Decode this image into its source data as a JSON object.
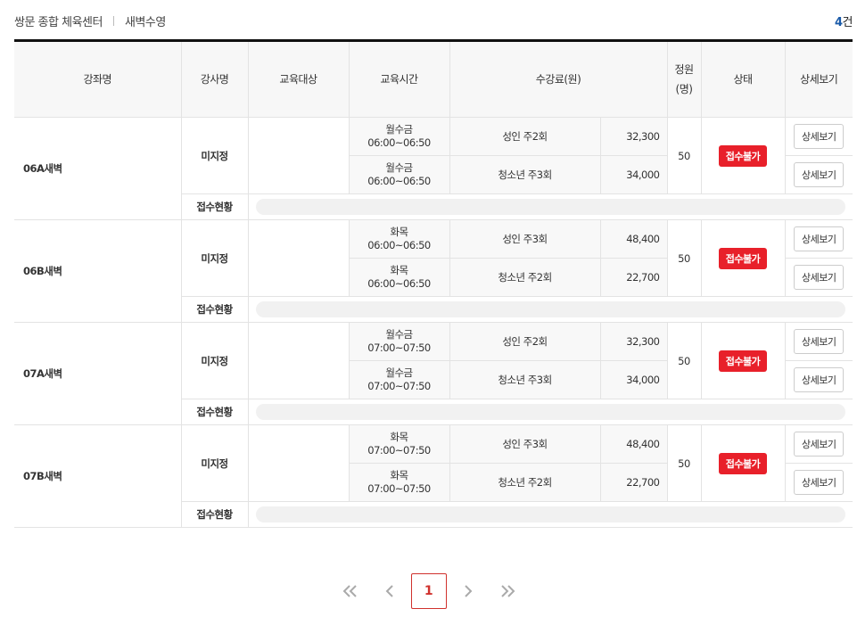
{
  "breadcrumb": {
    "center": "쌍문 종합 체육센터",
    "program": "새벽수영"
  },
  "count": {
    "num": "4",
    "unit": "건"
  },
  "table": {
    "headers": {
      "course": "강좌명",
      "instructor": "강사명",
      "target": "교육대상",
      "time": "교육시간",
      "fee": "수강료(원)",
      "capacity_line1": "정원",
      "capacity_line2": "(명)",
      "status": "상태",
      "detail": "상세보기"
    },
    "rows": [
      {
        "course": "06A새벽",
        "instructor": "미지정",
        "capacity": "50",
        "status": "접수불가",
        "progress_label": "접수현황",
        "sessions": [
          {
            "days": "월수금",
            "time": "06:00~06:50",
            "fee_name": "성인 주2회",
            "fee": "32,300",
            "detail": "상세보기"
          },
          {
            "days": "월수금",
            "time": "06:00~06:50",
            "fee_name": "청소년 주3회",
            "fee": "34,000",
            "detail": "상세보기"
          }
        ]
      },
      {
        "course": "06B새벽",
        "instructor": "미지정",
        "capacity": "50",
        "status": "접수불가",
        "progress_label": "접수현황",
        "sessions": [
          {
            "days": "화목",
            "time": "06:00~06:50",
            "fee_name": "성인 주3회",
            "fee": "48,400",
            "detail": "상세보기"
          },
          {
            "days": "화목",
            "time": "06:00~06:50",
            "fee_name": "청소년 주2회",
            "fee": "22,700",
            "detail": "상세보기"
          }
        ]
      },
      {
        "course": "07A새벽",
        "instructor": "미지정",
        "capacity": "50",
        "status": "접수불가",
        "progress_label": "접수현황",
        "sessions": [
          {
            "days": "월수금",
            "time": "07:00~07:50",
            "fee_name": "성인 주2회",
            "fee": "32,300",
            "detail": "상세보기"
          },
          {
            "days": "월수금",
            "time": "07:00~07:50",
            "fee_name": "청소년 주3회",
            "fee": "34,000",
            "detail": "상세보기"
          }
        ]
      },
      {
        "course": "07B새벽",
        "instructor": "미지정",
        "capacity": "50",
        "status": "접수불가",
        "progress_label": "접수현황",
        "sessions": [
          {
            "days": "화목",
            "time": "07:00~07:50",
            "fee_name": "성인 주3회",
            "fee": "48,400",
            "detail": "상세보기"
          },
          {
            "days": "화목",
            "time": "07:00~07:50",
            "fee_name": "청소년 주2회",
            "fee": "22,700",
            "detail": "상세보기"
          }
        ]
      }
    ]
  },
  "pagination": {
    "first_icon": "double-chevron-left-icon",
    "prev_icon": "chevron-left-icon",
    "current": "1",
    "next_icon": "chevron-right-icon",
    "last_icon": "double-chevron-right-icon"
  },
  "colors": {
    "accent": "#e8202a",
    "count_blue": "#1a5aa8",
    "page_active": "#d0312d"
  }
}
